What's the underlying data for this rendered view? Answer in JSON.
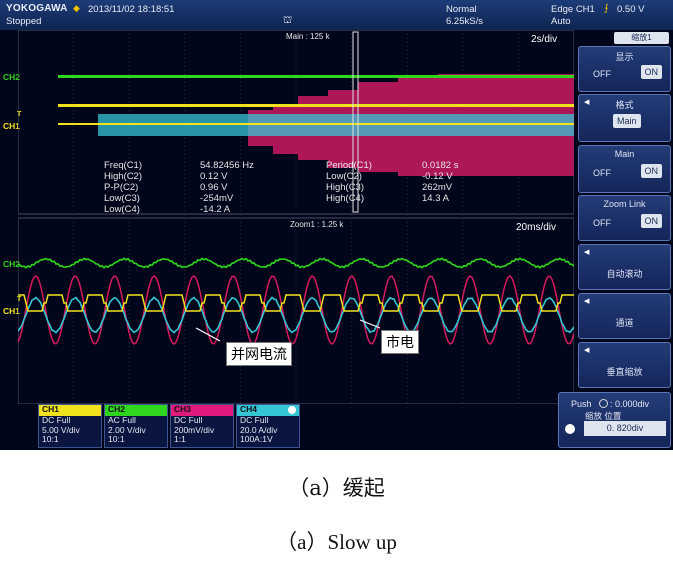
{
  "header": {
    "brand": "YOKOGAWA",
    "datetime": "2013/11/02 18:18:51",
    "run_state": "Stopped",
    "trigger_mode": "Normal",
    "sample_rate": "6.25kS/s",
    "trigger_type": "Edge CH1",
    "trigger_level": "0.50 V",
    "acq_mode": "Auto"
  },
  "main_window": {
    "label": "Main : 125 k",
    "timebase": "2s/div"
  },
  "zoom_window": {
    "label": "Zoom1 : 1.25 k",
    "timebase": "20ms/div"
  },
  "measurements": [
    {
      "name": "Freq(C1)",
      "value": "54.82456 Hz"
    },
    {
      "name": "High(C2)",
      "value": "0.12 V"
    },
    {
      "name": "P-P(C2)",
      "value": "0.96 V"
    },
    {
      "name": "Low(C3)",
      "value": "-254mV"
    },
    {
      "name": "Low(C4)",
      "value": "-14.2 A"
    },
    {
      "name": "Period(C1)",
      "value": "0.0182 s"
    },
    {
      "name": "Low(C2)",
      "value": "-0.12 V"
    },
    {
      "name": "High(C3)",
      "value": "262mV"
    },
    {
      "name": "High(C4)",
      "value": "14.3 A"
    }
  ],
  "channel_markers": {
    "ch2": "CH2",
    "ch1": "CH1",
    "trigger": "T"
  },
  "panel": {
    "tab": "缩放1",
    "display": {
      "title": "显示",
      "off": "OFF",
      "on": "ON"
    },
    "format": {
      "title": "格式",
      "value": "Main"
    },
    "main": {
      "title": "Main",
      "off": "OFF",
      "on": "ON"
    },
    "zoom_link": {
      "title": "Zoom Link",
      "off": "OFF",
      "on": "ON"
    },
    "auto_scroll": {
      "title": "自动滚动"
    },
    "channel": {
      "title": "通道"
    },
    "vertical_zoom": {
      "title": "垂直缩放"
    }
  },
  "push": {
    "label": "Push",
    "value_top": ": 0.000div",
    "sub_label": "缩放 位置",
    "position": "0. 820div"
  },
  "channels": [
    {
      "name": "CH1",
      "coupling": "DC Full",
      "scale": "5.00 V/div",
      "probe": "10:1",
      "color": "#f2e21e"
    },
    {
      "name": "CH2",
      "coupling": "AC Full",
      "scale": "2.00 V/div",
      "probe": "10:1",
      "color": "#2fd61e"
    },
    {
      "name": "CH3",
      "coupling": "DC Full",
      "scale": "200mV/div",
      "probe": "1:1",
      "color": "#e0197d"
    },
    {
      "name": "CH4",
      "coupling": "DC Full",
      "scale": "20.0 A/div",
      "probe": "100A:1V",
      "color": "#35c6d6"
    }
  ],
  "annotations": {
    "grid_current": "并网电流",
    "mains": "市电"
  },
  "captions": {
    "chinese": "（a）缓起",
    "english": "（a）Slow up"
  },
  "colors": {
    "ch1": "#f2e21e",
    "ch2": "#2fd61e",
    "ch3": "#e0197d",
    "ch4": "#35c6d6",
    "screen_bg": "#02061a",
    "header_bg": "#1d3c78"
  }
}
